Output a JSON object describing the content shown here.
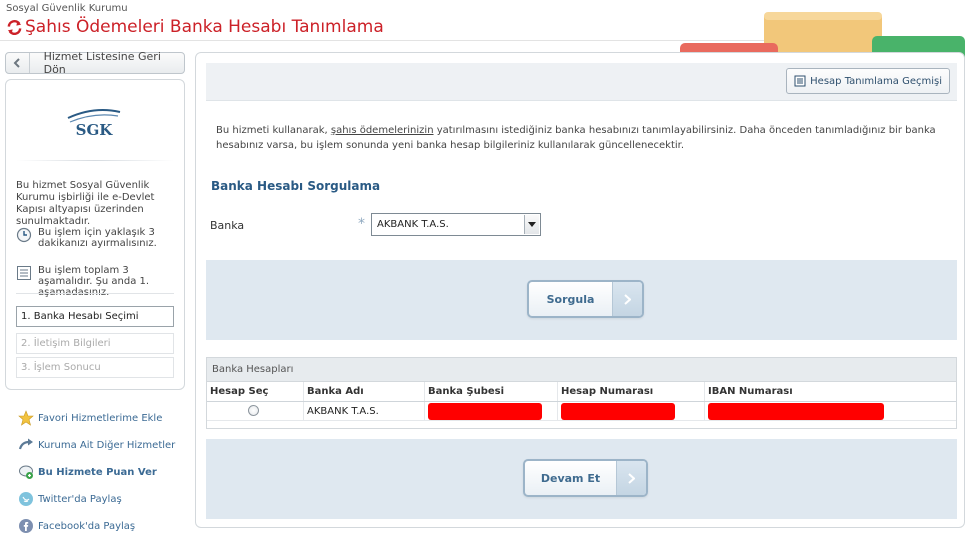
{
  "header": {
    "institution": "Sosyal Güvenlik Kurumu",
    "title": "Şahıs Ödemeleri Banka Hesabı Tanımlama"
  },
  "sidebar": {
    "back_label": "Hizmet Listesine Geri Dön",
    "logo_text": "SGK",
    "intro": "Bu hizmet Sosyal Güvenlik Kurumu işbirliği ile e-Devlet Kapısı altyapısı üzerinden sunulmaktadır.",
    "time_info": "Bu işlem için yaklaşık 3 dakikanızı ayırmalısınız.",
    "steps_info": "Bu işlem toplam 3 aşamalıdır. Şu anda 1. aşamadasınız.",
    "steps": [
      {
        "label": "1. Banka Hesabı Seçimi"
      },
      {
        "label": "2. İletişim Bilgileri"
      },
      {
        "label": "3. İşlem Sonucu"
      }
    ],
    "links": [
      {
        "label": "Favori Hizmetlerime Ekle"
      },
      {
        "label": "Kuruma Ait Diğer Hizmetler"
      },
      {
        "label": "Bu Hizmete Puan Ver"
      },
      {
        "label": "Twitter'da Paylaş"
      },
      {
        "label": "Facebook'da Paylaş"
      }
    ]
  },
  "main": {
    "history_button": "Hesap Tanımlama Geçmişi",
    "desc_part1": "Bu hizmeti kullanarak, ",
    "desc_link": "şahıs ödemelerinizin",
    "desc_part2": " yatırılmasını istediğiniz banka hesabınızı tanımlayabilirsiniz. Daha önceden tanımladığınız bir banka hesabınız varsa, bu işlem sonunda yeni banka hesap bilgileriniz kullanılarak güncellenecektir.",
    "section_title": "Banka Hesabı Sorgulama",
    "bank_label": "Banka",
    "required_mark": "*",
    "bank_selected": "AKBANK T.A.S.",
    "query_button": "Sorgula",
    "accounts_title": "Banka Hesapları",
    "columns": [
      "Hesap Seç",
      "Banka Adı",
      "Banka Şubesi",
      "Hesap Numarası",
      "IBAN Numarası"
    ],
    "row": {
      "bank_name": "AKBANK T.A.S."
    },
    "continue_button": "Devam Et"
  },
  "colors": {
    "title_red": "#cc2128",
    "accent_blue": "#2a5a84",
    "redaction": "#ff0000"
  }
}
